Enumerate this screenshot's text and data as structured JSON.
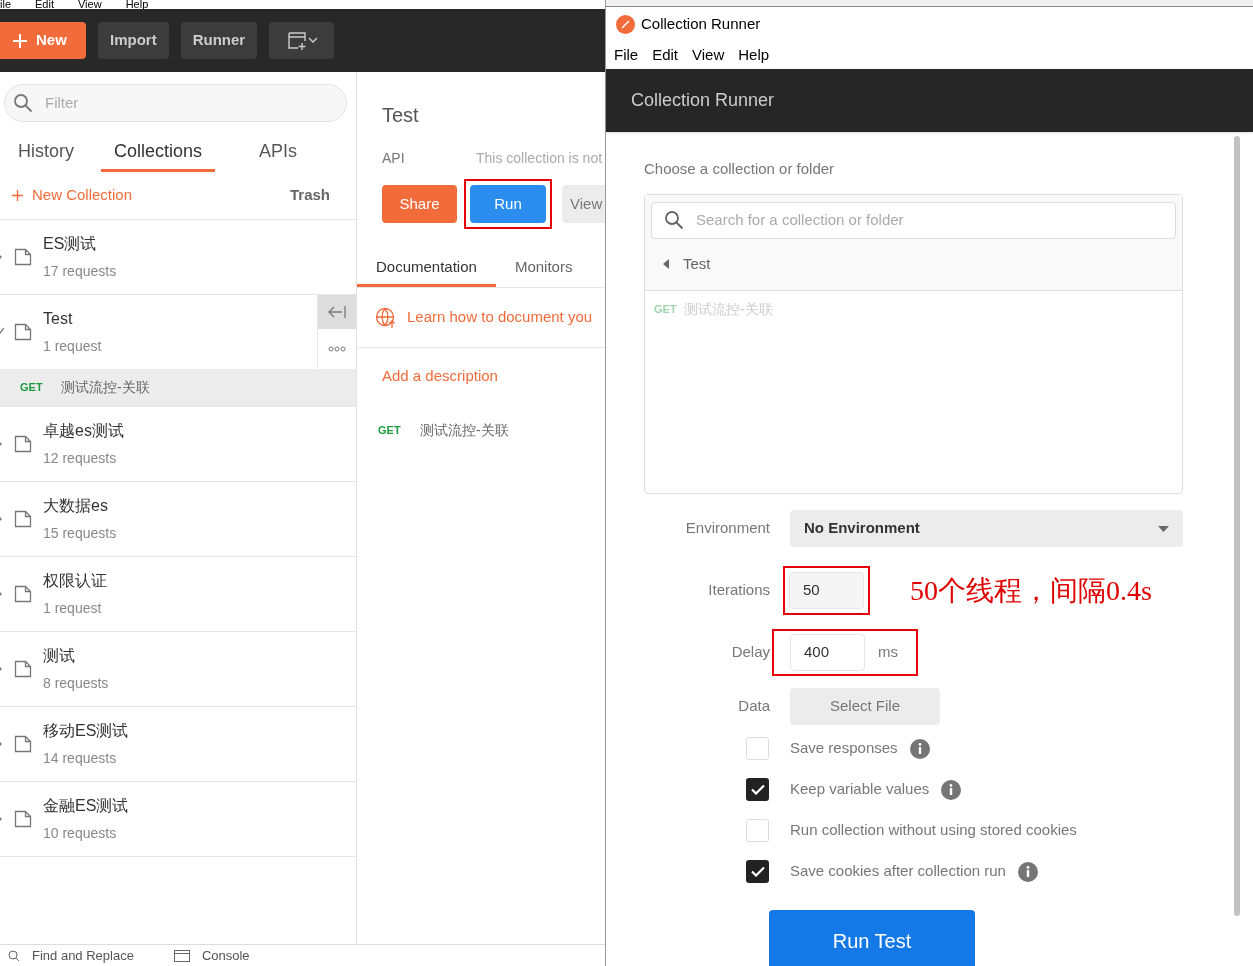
{
  "app_menu": [
    "ile",
    "Edit",
    "View",
    "Help"
  ],
  "toolbar": {
    "new": "New",
    "import": "Import",
    "runner": "Runner"
  },
  "sidebar": {
    "filter_placeholder": "Filter",
    "tabs": [
      {
        "label": "History",
        "selected": false
      },
      {
        "label": "Collections",
        "selected": true
      },
      {
        "label": "APIs",
        "selected": false
      }
    ],
    "new_collection": "New Collection",
    "trash": "Trash",
    "collections": [
      {
        "name": "ES测试",
        "count": "17 requests",
        "expanded": false
      },
      {
        "name": "Test",
        "count": "1 request",
        "expanded": true,
        "requests": [
          {
            "method": "GET",
            "name": "测试流控-关联"
          }
        ]
      },
      {
        "name": "卓越es测试",
        "count": "12 requests",
        "expanded": false
      },
      {
        "name": "大数据es",
        "count": "15 requests",
        "expanded": false
      },
      {
        "name": "权限认证",
        "count": "1 request",
        "expanded": false
      },
      {
        "name": "测试",
        "count": "8 requests",
        "expanded": false
      },
      {
        "name": "移动ES测试",
        "count": "14 requests",
        "expanded": false
      },
      {
        "name": "金融ES测试",
        "count": "10 requests",
        "expanded": false
      }
    ]
  },
  "collection_view": {
    "title": "Test",
    "api_label": "API",
    "api_note": "This collection is not",
    "share": "Share",
    "run": "Run",
    "view": "View",
    "tabs": [
      {
        "label": "Documentation",
        "selected": true
      },
      {
        "label": "Monitors",
        "selected": false
      }
    ],
    "learn_link": "Learn how to document you",
    "add_description": "Add a description",
    "requests": [
      {
        "method": "GET",
        "name": "测试流控-关联"
      }
    ]
  },
  "status_bar": [
    "Find and Replace",
    "Console"
  ],
  "runner": {
    "window_title": "Collection Runner",
    "menu": [
      "File",
      "Edit",
      "View",
      "Help"
    ],
    "header": "Collection Runner",
    "choose_label": "Choose a collection or folder",
    "search_placeholder": "Search for a collection or folder",
    "folder": "Test",
    "requests": [
      {
        "method": "GET",
        "name": "测试流控-关联"
      }
    ],
    "environment_label": "Environment",
    "environment": "No Environment",
    "iterations_label": "Iterations",
    "iterations": "50",
    "delay_label": "Delay",
    "delay": "400",
    "delay_unit": "ms",
    "data_label": "Data",
    "select_file": "Select File",
    "options": [
      {
        "label": "Save responses",
        "checked": false,
        "info": true
      },
      {
        "label": "Keep variable values",
        "checked": true,
        "info": true
      },
      {
        "label": "Run collection without using stored cookies",
        "checked": false,
        "info": false
      },
      {
        "label": "Save cookies after collection run",
        "checked": true,
        "info": true
      }
    ],
    "run_button": "Run Test",
    "annotation": "50个线程，间隔0.4s"
  }
}
